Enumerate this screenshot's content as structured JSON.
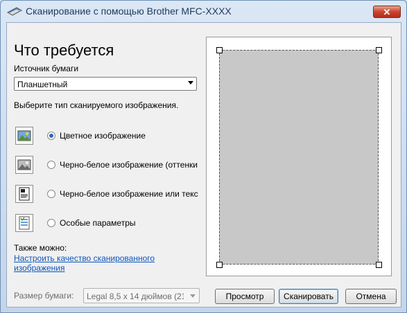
{
  "window": {
    "title": "Сканирование с помощью Brother MFC-XXXX",
    "close_label": "✕"
  },
  "heading": "Что требуется",
  "paper_source": {
    "label": "Источник бумаги",
    "value": "Планшетный"
  },
  "scan_type_prompt": "Выберите тип сканируемого изображения.",
  "scan_types": [
    {
      "label": "Цветное изображение",
      "selected": true
    },
    {
      "label": "Черно-белое изображение (оттенки",
      "selected": false
    },
    {
      "label": "Черно-белое изображение или текс",
      "selected": false
    },
    {
      "label": "Особые параметры",
      "selected": false
    }
  ],
  "also": {
    "label": "Также можно:",
    "link": "Настроить качество сканированного изображения"
  },
  "paper_size": {
    "label": "Размер бумаги:",
    "value": "Legal 8,5 x 14 дюймов (21("
  },
  "buttons": {
    "preview": "Просмотр",
    "scan": "Сканировать",
    "cancel": "Отмена"
  },
  "colors": {
    "accent": "#2c6bb5",
    "link": "#0f55b9",
    "preview_fill": "#c8c8c8"
  }
}
